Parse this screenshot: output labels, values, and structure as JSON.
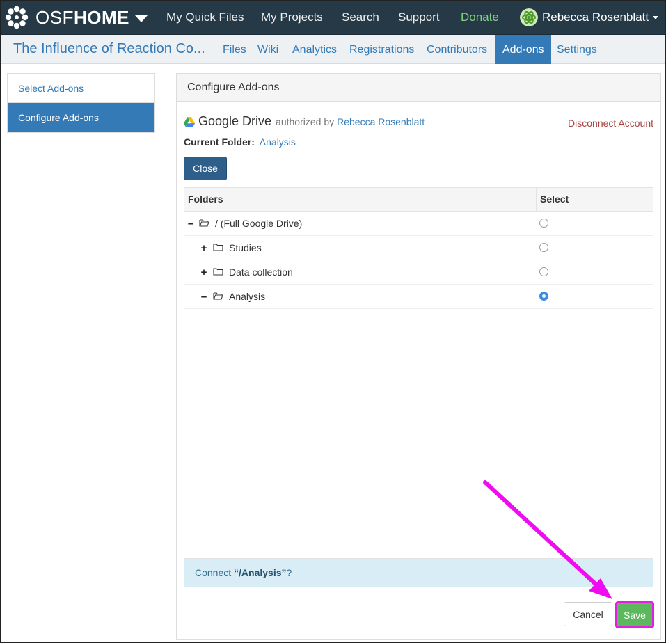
{
  "topnav": {
    "brand_osf": "OSF",
    "brand_home": "HOME",
    "links": [
      "My Quick Files",
      "My Projects",
      "Search",
      "Support",
      "Donate"
    ],
    "user": "Rebecca Rosenblatt"
  },
  "subnav": {
    "project_title": "The Influence of Reaction Co...",
    "tabs": [
      "Files",
      "Wiki",
      "Analytics",
      "Registrations",
      "Contributors",
      "Add-ons",
      "Settings"
    ],
    "active_tab": "Add-ons"
  },
  "leftnav": {
    "items": [
      "Select Add-ons",
      "Configure Add-ons"
    ],
    "active": "Configure Add-ons"
  },
  "panel": {
    "heading": "Configure Add-ons",
    "addon_name": "Google Drive",
    "authorized_by": "authorized by",
    "auth_user": "Rebecca Rosenblatt",
    "disconnect": "Disconnect Account",
    "current_folder_label": "Current Folder:",
    "current_folder_value": "Analysis",
    "close_label": "Close",
    "tree": {
      "col_folders": "Folders",
      "col_select": "Select",
      "rows": [
        {
          "toggle": "–",
          "name": "/ (Full Google Drive)",
          "open": true,
          "checked": false
        },
        {
          "toggle": "+",
          "name": "Studies",
          "open": false,
          "checked": false
        },
        {
          "toggle": "+",
          "name": "Data collection",
          "open": false,
          "checked": false
        },
        {
          "toggle": "–",
          "name": "Analysis",
          "open": true,
          "checked": true
        }
      ]
    },
    "connect_prefix": "Connect ",
    "connect_target": "“/Analysis”",
    "connect_suffix": "?",
    "cancel_label": "Cancel",
    "save_label": "Save"
  },
  "colors": {
    "navbar": "#263947",
    "accent": "#337ab7",
    "donate": "#7fd27f",
    "save": "#5cb85c",
    "highlight": "#e41ce4",
    "danger": "#a94442"
  }
}
